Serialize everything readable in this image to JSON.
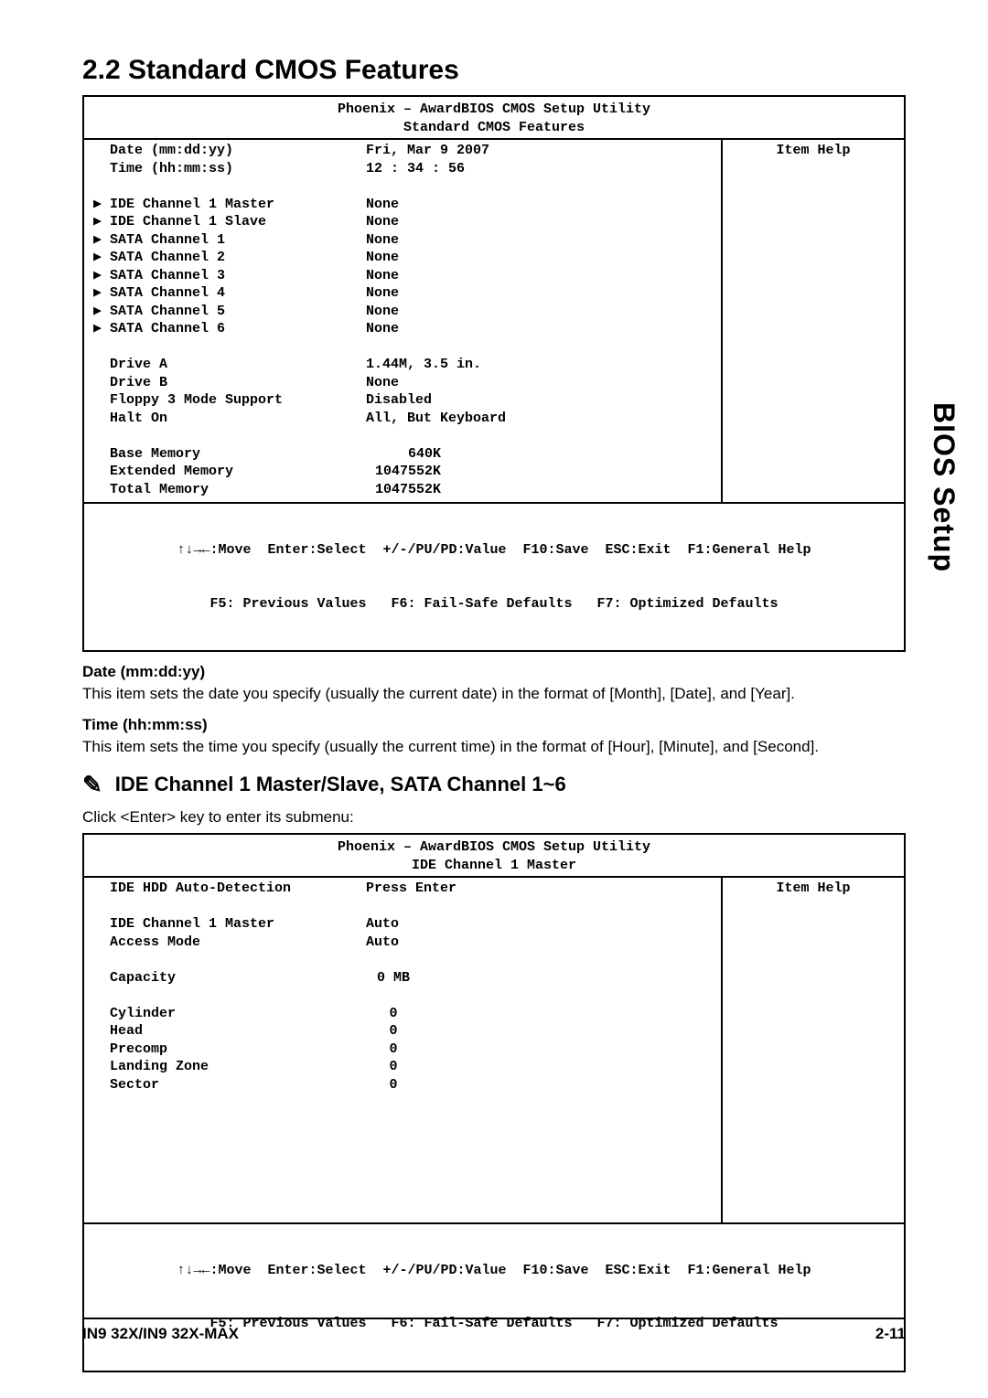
{
  "section_title": "2.2 Standard CMOS Features",
  "box1": {
    "header_line1": "Phoenix – AwardBIOS CMOS Setup Utility",
    "header_line2": "Standard CMOS Features",
    "item_help": "Item Help",
    "rows": [
      {
        "pointer": "",
        "label": "Date (mm:dd:yy)",
        "value": "Fri, Mar 9 2007"
      },
      {
        "pointer": "",
        "label": "Time (hh:mm:ss)",
        "value": "12 : 34 : 56"
      },
      {
        "spacer": true
      },
      {
        "pointer": "▶",
        "label": "IDE Channel 1 Master",
        "value": "None"
      },
      {
        "pointer": "▶",
        "label": "IDE Channel 1 Slave",
        "value": "None"
      },
      {
        "pointer": "▶",
        "label": "SATA Channel 1",
        "value": "None"
      },
      {
        "pointer": "▶",
        "label": "SATA Channel 2",
        "value": "None"
      },
      {
        "pointer": "▶",
        "label": "SATA Channel 3",
        "value": "None"
      },
      {
        "pointer": "▶",
        "label": "SATA Channel 4",
        "value": "None"
      },
      {
        "pointer": "▶",
        "label": "SATA Channel 5",
        "value": "None"
      },
      {
        "pointer": "▶",
        "label": "SATA Channel 6",
        "value": "None"
      },
      {
        "spacer": true
      },
      {
        "pointer": "",
        "label": "Drive A",
        "value": "1.44M, 3.5 in."
      },
      {
        "pointer": "",
        "label": "Drive B",
        "value": "None"
      },
      {
        "pointer": "",
        "label": "Floppy 3 Mode Support",
        "value": "Disabled"
      },
      {
        "pointer": "",
        "label": "Halt On",
        "value": "All, But Keyboard"
      },
      {
        "spacer": true
      },
      {
        "pointer": "",
        "label": "Base Memory",
        "value": "640K",
        "right": true
      },
      {
        "pointer": "",
        "label": "Extended Memory",
        "value": "1047552K",
        "right": true
      },
      {
        "pointer": "",
        "label": "Total Memory",
        "value": "1047552K",
        "right": true
      }
    ],
    "footer_line1": "↑↓→←:Move  Enter:Select  +/-/PU/PD:Value  F10:Save  ESC:Exit  F1:General Help",
    "footer_line2": "F5: Previous Values   F6: Fail-Safe Defaults   F7: Optimized Defaults"
  },
  "opt1": {
    "heading": "Date (mm:dd:yy)",
    "text": "This item sets the date you specify (usually the current date) in the format of [Month], [Date], and [Year]."
  },
  "opt2": {
    "heading": "Time (hh:mm:ss)",
    "text": "This item sets the time you specify (usually the current time) in the format of [Hour], [Minute], and [Second]."
  },
  "submenu": {
    "icon": "✎",
    "heading": "IDE Channel 1 Master/Slave, SATA Channel 1~6",
    "text": "Click <Enter> key to enter its submenu:"
  },
  "box2": {
    "header_line1": "Phoenix – AwardBIOS CMOS Setup Utility",
    "header_line2": "IDE Channel 1 Master",
    "item_help": "Item Help",
    "rows": [
      {
        "pointer": "",
        "label": "IDE HDD Auto-Detection",
        "value": "Press Enter"
      },
      {
        "spacer": true
      },
      {
        "pointer": "",
        "label": "IDE Channel 1 Master",
        "value": "Auto"
      },
      {
        "pointer": "",
        "label": "Access Mode",
        "value": "Auto"
      },
      {
        "spacer": true
      },
      {
        "pointer": "",
        "label": "Capacity",
        "value": "0 MB",
        "center": true
      },
      {
        "spacer": true
      },
      {
        "pointer": "",
        "label": "Cylinder",
        "value": "0",
        "center": true
      },
      {
        "pointer": "",
        "label": "Head",
        "value": "0",
        "center": true
      },
      {
        "pointer": "",
        "label": "Precomp",
        "value": "0",
        "center": true
      },
      {
        "pointer": "",
        "label": "Landing Zone",
        "value": "0",
        "center": true
      },
      {
        "pointer": "",
        "label": "Sector",
        "value": "0",
        "center": true
      },
      {
        "spacer": true
      },
      {
        "spacer": true
      },
      {
        "spacer": true
      },
      {
        "spacer": true
      },
      {
        "spacer": true
      },
      {
        "spacer": true
      },
      {
        "spacer": true
      }
    ],
    "footer_line1": "↑↓→←:Move  Enter:Select  +/-/PU/PD:Value  F10:Save  ESC:Exit  F1:General Help",
    "footer_line2": "F5: Previous Values   F6: Fail-Safe Defaults   F7: Optimized Defaults"
  },
  "side_tab": "BIOS Setup",
  "footer": {
    "left": "IN9 32X/IN9 32X-MAX",
    "right": "2-11"
  }
}
